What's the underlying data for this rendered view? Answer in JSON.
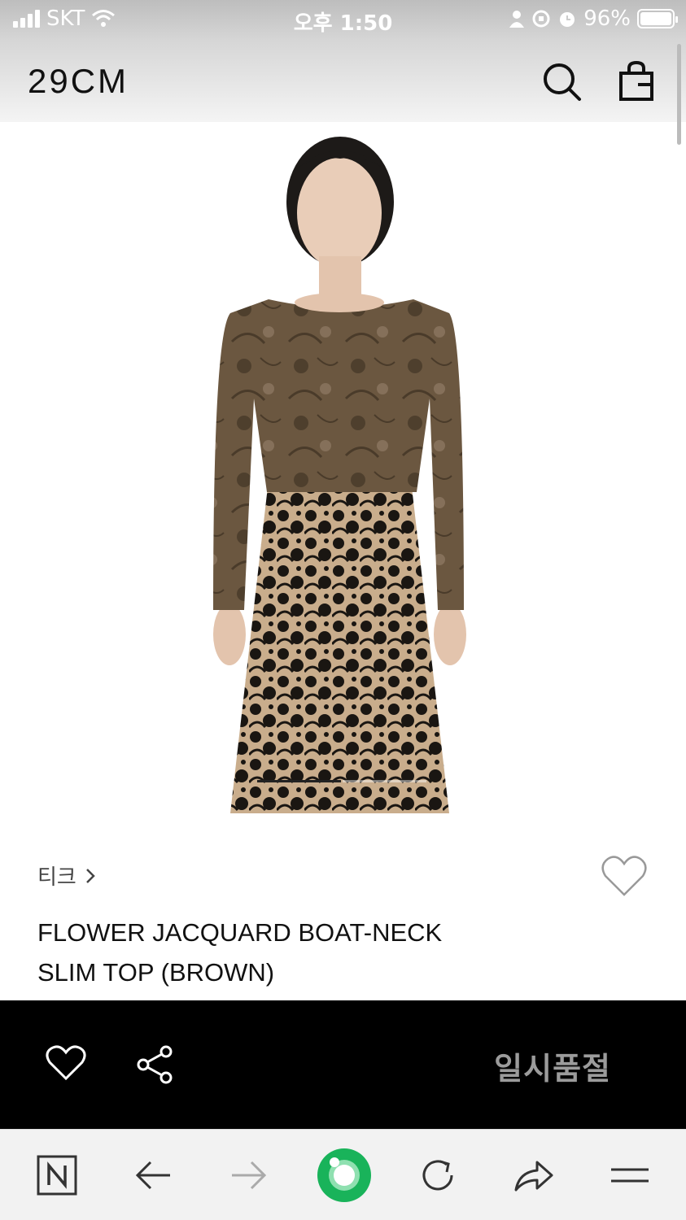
{
  "status_bar": {
    "carrier": "SKT",
    "time": "오후 1:50",
    "battery": "96%"
  },
  "header": {
    "logo": "29CM"
  },
  "hero": {
    "image_alt": "Model wearing brown flower jacquard boat-neck slim top with black lace-pattern skirt",
    "carousel": {
      "count": 2,
      "active_index": 0
    }
  },
  "product": {
    "brand": "티크",
    "title_line1": "FLOWER JACQUARD BOAT-NECK",
    "title_line2": "SLIM TOP (BROWN)"
  },
  "action_bar": {
    "status_label": "일시품절"
  },
  "colors": {
    "accent_green": "#19b35a",
    "action_bar_bg": "#000000",
    "soldout_text": "#9b9b9b",
    "top_brown": "#6b5740"
  }
}
